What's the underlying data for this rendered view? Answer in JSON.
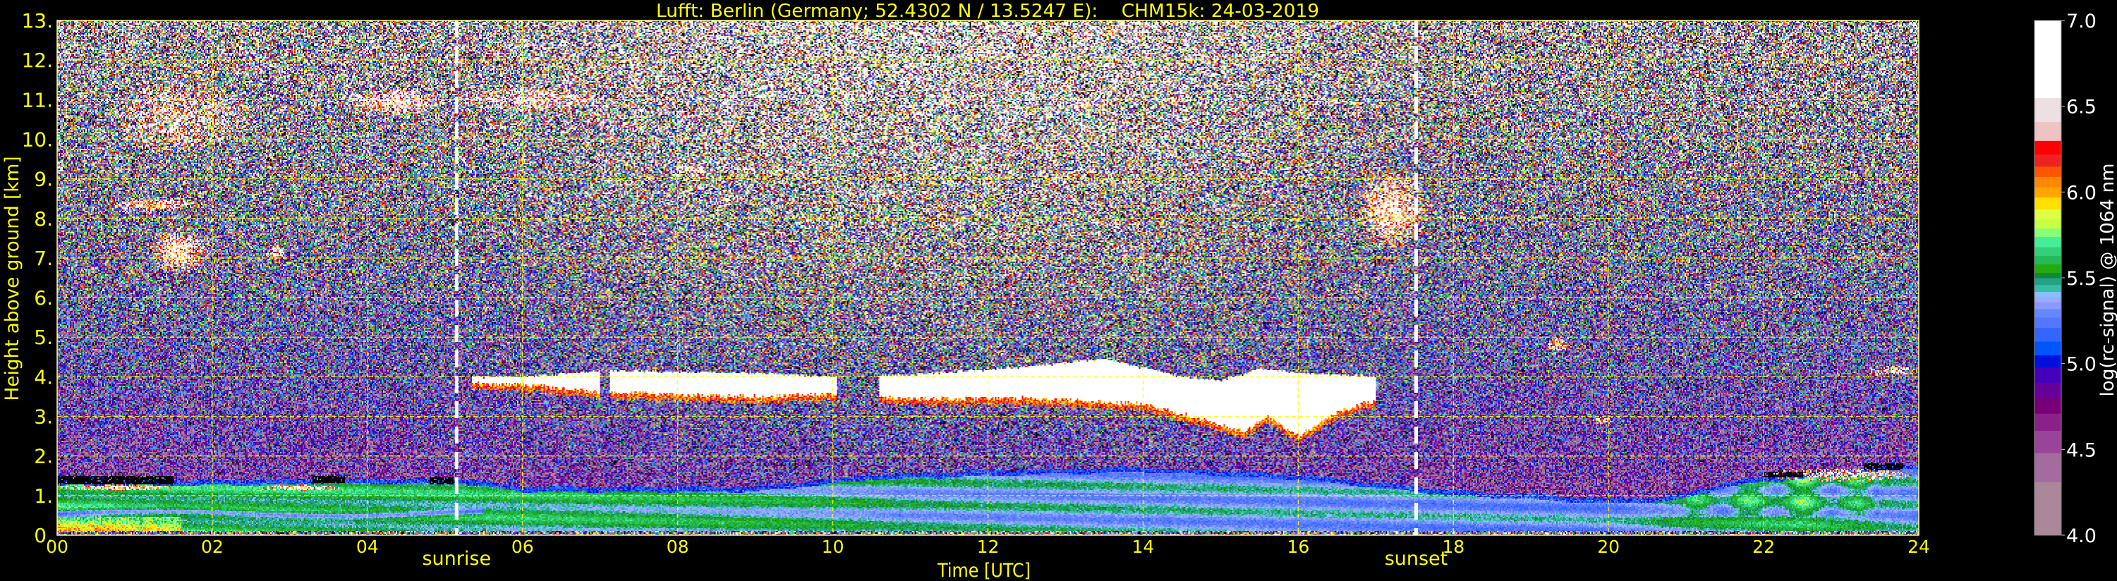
{
  "chart_data": {
    "type": "heatmap",
    "title": "Lufft: Berlin (Germany; 52.4302 N / 13.5247 E):    CHM15k: 24-03-2019",
    "xlabel": "Time [UTC]",
    "ylabel": "Height above ground [km]",
    "xlim": [
      0,
      24
    ],
    "ylim": [
      0,
      13
    ],
    "grid": true,
    "x_ticks": [
      {
        "value": 0,
        "label": "00"
      },
      {
        "value": 2,
        "label": "02"
      },
      {
        "value": 4,
        "label": "04"
      },
      {
        "value": 6,
        "label": "06"
      },
      {
        "value": 8,
        "label": "08"
      },
      {
        "value": 10,
        "label": "10"
      },
      {
        "value": 12,
        "label": "12"
      },
      {
        "value": 14,
        "label": "14"
      },
      {
        "value": 16,
        "label": "16"
      },
      {
        "value": 18,
        "label": "18"
      },
      {
        "value": 20,
        "label": "20"
      },
      {
        "value": 22,
        "label": "22"
      },
      {
        "value": 24,
        "label": "24"
      }
    ],
    "y_ticks": [
      {
        "value": 0,
        "label": "0."
      },
      {
        "value": 1,
        "label": "1."
      },
      {
        "value": 2,
        "label": "2."
      },
      {
        "value": 3,
        "label": "3."
      },
      {
        "value": 4,
        "label": "4."
      },
      {
        "value": 5,
        "label": "5."
      },
      {
        "value": 6,
        "label": "6."
      },
      {
        "value": 7,
        "label": "7."
      },
      {
        "value": 8,
        "label": "8."
      },
      {
        "value": 9,
        "label": "9."
      },
      {
        "value": 10,
        "label": "10."
      },
      {
        "value": 11,
        "label": "11."
      },
      {
        "value": 12,
        "label": "12."
      },
      {
        "value": 13,
        "label": "13."
      }
    ],
    "annotations": [
      {
        "label": "sunrise",
        "time_utc": 5.15
      },
      {
        "label": "sunset",
        "time_utc": 17.52
      }
    ],
    "colorbar": {
      "label": "log(rc-signal) @ 1064 nm",
      "range": [
        4.0,
        7.0
      ],
      "ticks": [
        {
          "value": 4.0,
          "label": "4.0"
        },
        {
          "value": 4.5,
          "label": "4.5"
        },
        {
          "value": 5.0,
          "label": "5.0"
        },
        {
          "value": 5.5,
          "label": "5.5"
        },
        {
          "value": 6.0,
          "label": "6.0"
        },
        {
          "value": 6.5,
          "label": "6.5"
        },
        {
          "value": 7.0,
          "label": "7.0"
        }
      ],
      "levels": [
        {
          "from": 4.0,
          "to": 4.31,
          "color": "#aa8899"
        },
        {
          "from": 4.31,
          "to": 4.48,
          "color": "#a46c9e"
        },
        {
          "from": 4.48,
          "to": 4.61,
          "color": "#994499"
        },
        {
          "from": 4.61,
          "to": 4.71,
          "color": "#882288"
        },
        {
          "from": 4.71,
          "to": 4.8,
          "color": "#770077"
        },
        {
          "from": 4.8,
          "to": 4.89,
          "color": "#660099"
        },
        {
          "from": 4.89,
          "to": 4.98,
          "color": "#4400bb"
        },
        {
          "from": 4.98,
          "to": 5.05,
          "color": "#0011dd"
        },
        {
          "from": 5.05,
          "to": 5.13,
          "color": "#0055ff"
        },
        {
          "from": 5.13,
          "to": 5.21,
          "color": "#3366ff"
        },
        {
          "from": 5.21,
          "to": 5.27,
          "color": "#5577ff"
        },
        {
          "from": 5.27,
          "to": 5.32,
          "color": "#6688ff"
        },
        {
          "from": 5.32,
          "to": 5.36,
          "color": "#8899ff"
        },
        {
          "from": 5.36,
          "to": 5.39,
          "color": "#99aaff"
        },
        {
          "from": 5.39,
          "to": 5.42,
          "color": "#88c0ff"
        },
        {
          "from": 5.42,
          "to": 5.46,
          "color": "#33c0a0"
        },
        {
          "from": 5.46,
          "to": 5.5,
          "color": "#22a088"
        },
        {
          "from": 5.5,
          "to": 5.53,
          "color": "#118833"
        },
        {
          "from": 5.53,
          "to": 5.58,
          "color": "#22aa11"
        },
        {
          "from": 5.58,
          "to": 5.63,
          "color": "#22bb55"
        },
        {
          "from": 5.63,
          "to": 5.68,
          "color": "#33d077"
        },
        {
          "from": 5.68,
          "to": 5.74,
          "color": "#44ee99"
        },
        {
          "from": 5.74,
          "to": 5.79,
          "color": "#88ff77"
        },
        {
          "from": 5.79,
          "to": 5.84,
          "color": "#c8ff40"
        },
        {
          "from": 5.84,
          "to": 5.9,
          "color": "#ddff44"
        },
        {
          "from": 5.9,
          "to": 5.97,
          "color": "#ffe000"
        },
        {
          "from": 5.97,
          "to": 6.03,
          "color": "#ffa500"
        },
        {
          "from": 6.03,
          "to": 6.09,
          "color": "#ff8800"
        },
        {
          "from": 6.09,
          "to": 6.15,
          "color": "#ff5500"
        },
        {
          "from": 6.15,
          "to": 6.22,
          "color": "#ee2222"
        },
        {
          "from": 6.22,
          "to": 6.3,
          "color": "#ff0000"
        },
        {
          "from": 6.3,
          "to": 6.41,
          "color": "#efc2c4"
        },
        {
          "from": 6.41,
          "to": 6.55,
          "color": "#ece0e2"
        },
        {
          "from": 6.55,
          "to": 7.0,
          "color": "#ffffff"
        }
      ]
    },
    "features": {
      "boundary_layer_top_km": [
        [
          0,
          1.25
        ],
        [
          1.5,
          1.25
        ],
        [
          4,
          1.3
        ],
        [
          5.2,
          1.3
        ],
        [
          6,
          1.1
        ],
        [
          9,
          1.1
        ],
        [
          10.5,
          1.4
        ],
        [
          12,
          1.5
        ],
        [
          14,
          1.6
        ],
        [
          16,
          1.4
        ],
        [
          17,
          1.2
        ],
        [
          18,
          1.0
        ],
        [
          19,
          0.9
        ],
        [
          20,
          0.8
        ],
        [
          20.8,
          0.85
        ],
        [
          21.5,
          1.2
        ],
        [
          22,
          1.35
        ],
        [
          23,
          1.5
        ],
        [
          24,
          1.7
        ]
      ],
      "boundary_layer_signal": [
        [
          0,
          5.6
        ],
        [
          5,
          5.55
        ],
        [
          8,
          5.5
        ],
        [
          10,
          5.45
        ],
        [
          11,
          5.4
        ],
        [
          16,
          5.35
        ],
        [
          20,
          5.33
        ],
        [
          21,
          5.45
        ],
        [
          22.5,
          5.55
        ],
        [
          23.5,
          5.4
        ],
        [
          24,
          5.35
        ]
      ],
      "mid_cloud_base_km": [
        [
          5.35,
          3.85
        ],
        [
          6,
          3.8
        ],
        [
          7,
          3.6
        ],
        [
          9,
          3.5
        ],
        [
          10,
          3.55
        ],
        [
          11,
          3.45
        ],
        [
          12.5,
          3.45
        ],
        [
          14,
          3.3
        ],
        [
          14.8,
          2.9
        ],
        [
          15.3,
          2.6
        ],
        [
          15.6,
          3.0
        ],
        [
          16,
          2.5
        ],
        [
          16.5,
          3.1
        ],
        [
          17,
          3.4
        ]
      ],
      "mid_cloud_top_km": [
        [
          5.35,
          4.0
        ],
        [
          6,
          4.0
        ],
        [
          7,
          4.15
        ],
        [
          9,
          4.1
        ],
        [
          10,
          4.0
        ],
        [
          11,
          4.05
        ],
        [
          12.5,
          4.25
        ],
        [
          13.5,
          4.45
        ],
        [
          14.5,
          4.0
        ],
        [
          15,
          3.9
        ],
        [
          15.5,
          4.2
        ],
        [
          16,
          4.1
        ],
        [
          17,
          4.0
        ]
      ],
      "cloud_patches": [
        {
          "t": [
            0.7,
            2.5
          ],
          "h": [
            9.7,
            11.4
          ],
          "strength": 0.55
        },
        {
          "t": [
            3.6,
            5.0
          ],
          "h": [
            10.6,
            11.3
          ],
          "strength": 0.7
        },
        {
          "t": [
            5.2,
            7.0
          ],
          "h": [
            10.7,
            11.3
          ],
          "strength": 0.6
        },
        {
          "t": [
            11.3,
            11.6
          ],
          "h": [
            10.8,
            11.1
          ],
          "strength": 0.5
        },
        {
          "t": [
            13.1,
            13.4
          ],
          "h": [
            10.7,
            11.0
          ],
          "strength": 0.5
        },
        {
          "t": [
            7.9,
            8.4
          ],
          "h": [
            9.0,
            9.4
          ],
          "strength": 0.6
        },
        {
          "t": [
            1.2,
            1.95
          ],
          "h": [
            6.6,
            7.8
          ],
          "strength": 0.9
        },
        {
          "t": [
            0.6,
            1.9
          ],
          "h": [
            8.2,
            8.5
          ],
          "strength": 0.8
        },
        {
          "t": [
            2.7,
            2.95
          ],
          "h": [
            6.9,
            7.4
          ],
          "strength": 0.8
        },
        {
          "t": [
            16.75,
            17.65
          ],
          "h": [
            7.2,
            9.2
          ],
          "strength": 0.9
        },
        {
          "t": [
            19.2,
            19.5
          ],
          "h": [
            4.6,
            5.0
          ],
          "strength": 0.7
        },
        {
          "t": [
            19.8,
            20.05
          ],
          "h": [
            2.8,
            3.0
          ],
          "strength": 0.8
        },
        {
          "t": [
            23.3,
            24.0
          ],
          "h": [
            4.0,
            4.3
          ],
          "strength": 0.6
        },
        {
          "t": [
            0.0,
            1.5
          ],
          "h": [
            1.12,
            1.28
          ],
          "strength": 0.9
        },
        {
          "t": [
            2.5,
            3.7
          ],
          "h": [
            1.12,
            1.28
          ],
          "strength": 0.8
        },
        {
          "t": [
            22.0,
            24.0
          ],
          "h": [
            1.35,
            1.7
          ],
          "strength": 0.6
        }
      ],
      "no_data": [
        {
          "t": [
            0.0,
            1.5
          ],
          "h": [
            1.28,
            1.5
          ]
        },
        {
          "t": [
            3.3,
            3.7
          ],
          "h": [
            1.32,
            1.48
          ]
        },
        {
          "t": [
            4.8,
            5.1
          ],
          "h": [
            1.3,
            1.45
          ]
        },
        {
          "t": [
            22.0,
            22.5
          ],
          "h": [
            1.45,
            1.62
          ]
        },
        {
          "t": [
            23.3,
            23.8
          ],
          "h": [
            1.65,
            1.82
          ]
        }
      ]
    },
    "colors": {
      "text": "#ffff00",
      "grid": "#ffff00",
      "marker_lines": "#ffffff",
      "background": "#000000"
    }
  }
}
